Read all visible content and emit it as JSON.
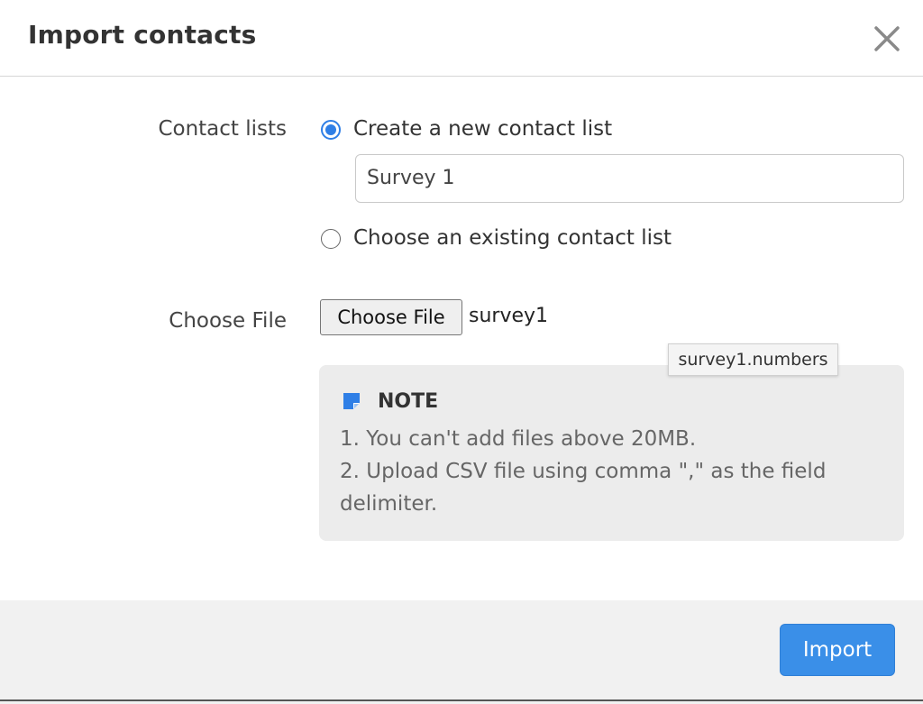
{
  "dialog": {
    "title": "Import contacts",
    "close_icon": "close-icon"
  },
  "form": {
    "contact_lists": {
      "label": "Contact lists",
      "options": [
        {
          "label": "Create a new contact list",
          "selected": true
        },
        {
          "label": "Choose an existing contact list",
          "selected": false
        }
      ],
      "new_list_name": "Survey 1"
    },
    "file": {
      "label": "Choose File",
      "button_label": "Choose File",
      "selected_file": "survey1",
      "tooltip": "survey1.numbers"
    }
  },
  "note": {
    "icon": "note-icon",
    "title": "NOTE",
    "lines": [
      "1. You can't add files above 20MB.",
      "2. Upload CSV file using comma \",\" as the field",
      "delimiter."
    ]
  },
  "footer": {
    "import_label": "Import"
  },
  "colors": {
    "accent": "#2f7fe6",
    "import_button": "#3a8fe8",
    "note_background": "#ececec",
    "footer_background": "#f1f1f1"
  }
}
